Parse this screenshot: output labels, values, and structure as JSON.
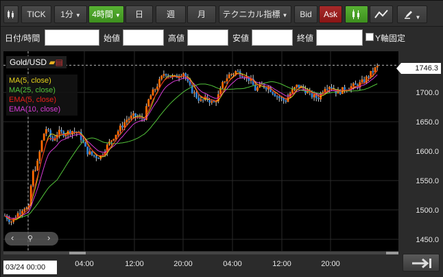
{
  "toolbar": {
    "tick_label": "TICK",
    "interval_label": "1分",
    "timeframe_label": "4時間",
    "day_label": "日",
    "week_label": "週",
    "month_label": "月",
    "indicator_label": "テクニカル指標",
    "bid_label": "Bid",
    "ask_label": "Ask"
  },
  "ohlc": {
    "datetime_label": "日付/時間",
    "open_label": "始値",
    "high_label": "高値",
    "low_label": "安値",
    "close_label": "終値",
    "yfix_label": "Y軸固定"
  },
  "symbol": "Gold/USD",
  "legend": [
    {
      "text": "MA(5, close)",
      "color": "#e6d21a"
    },
    {
      "text": "MA(25, close)",
      "color": "#53c43a"
    },
    {
      "text": "EMA(5, close)",
      "color": "#e8201a"
    },
    {
      "text": "EMA(10, close)",
      "color": "#d83bd8"
    }
  ],
  "crosshair_date": "03/24 00:00",
  "current_price": "1746.3",
  "colors": {
    "up": "#ff6a00",
    "down": "#2a7fd4",
    "background": "#000000",
    "grid": "#2a2a2a"
  },
  "chart_data": {
    "type": "candlestick",
    "title": "Gold/USD",
    "timeframe": "4時間",
    "ylim": [
      1430,
      1770
    ],
    "yticks": [
      1450.0,
      1500.0,
      1550.0,
      1600.0,
      1650.0,
      1700.0
    ],
    "xticks": [
      "03/24 00:00",
      "04:00",
      "12:00",
      "20:00",
      "04:00",
      "12:00",
      "20:00"
    ],
    "last_price": 1746.3,
    "grid": true,
    "series": [
      {
        "name": "MA(5, close)",
        "color": "#e6d21a"
      },
      {
        "name": "MA(25, close)",
        "color": "#53c43a"
      },
      {
        "name": "EMA(5, close)",
        "color": "#e8201a"
      },
      {
        "name": "EMA(10, close)",
        "color": "#d83bd8"
      }
    ],
    "price_path": [
      [
        0,
        1490
      ],
      [
        10,
        1480
      ],
      [
        20,
        1495
      ],
      [
        28,
        1505
      ],
      [
        35,
        1500
      ],
      [
        40,
        1560
      ],
      [
        48,
        1580
      ],
      [
        55,
        1620
      ],
      [
        60,
        1640
      ],
      [
        70,
        1618
      ],
      [
        78,
        1632
      ],
      [
        88,
        1630
      ],
      [
        100,
        1635
      ],
      [
        110,
        1628
      ],
      [
        120,
        1600
      ],
      [
        130,
        1592
      ],
      [
        140,
        1590
      ],
      [
        150,
        1608
      ],
      [
        160,
        1625
      ],
      [
        170,
        1640
      ],
      [
        180,
        1655
      ],
      [
        190,
        1660
      ],
      [
        200,
        1655
      ],
      [
        205,
        1658
      ],
      [
        212,
        1690
      ],
      [
        220,
        1705
      ],
      [
        228,
        1720
      ],
      [
        235,
        1735
      ],
      [
        242,
        1728
      ],
      [
        250,
        1725
      ],
      [
        262,
        1735
      ],
      [
        270,
        1712
      ],
      [
        278,
        1698
      ],
      [
        288,
        1685
      ],
      [
        298,
        1690
      ],
      [
        306,
        1680
      ],
      [
        314,
        1695
      ],
      [
        322,
        1720
      ],
      [
        330,
        1730
      ],
      [
        340,
        1736
      ],
      [
        350,
        1730
      ],
      [
        360,
        1722
      ],
      [
        368,
        1705
      ],
      [
        378,
        1712
      ],
      [
        388,
        1708
      ],
      [
        396,
        1698
      ],
      [
        404,
        1690
      ],
      [
        412,
        1685
      ],
      [
        420,
        1700
      ],
      [
        430,
        1712
      ],
      [
        440,
        1705
      ],
      [
        450,
        1695
      ],
      [
        460,
        1690
      ],
      [
        470,
        1710
      ],
      [
        478,
        1712
      ],
      [
        488,
        1700
      ],
      [
        498,
        1705
      ],
      [
        508,
        1710
      ],
      [
        518,
        1712
      ],
      [
        528,
        1720
      ],
      [
        536,
        1730
      ],
      [
        544,
        1740
      ],
      [
        550,
        1746.3
      ]
    ]
  }
}
